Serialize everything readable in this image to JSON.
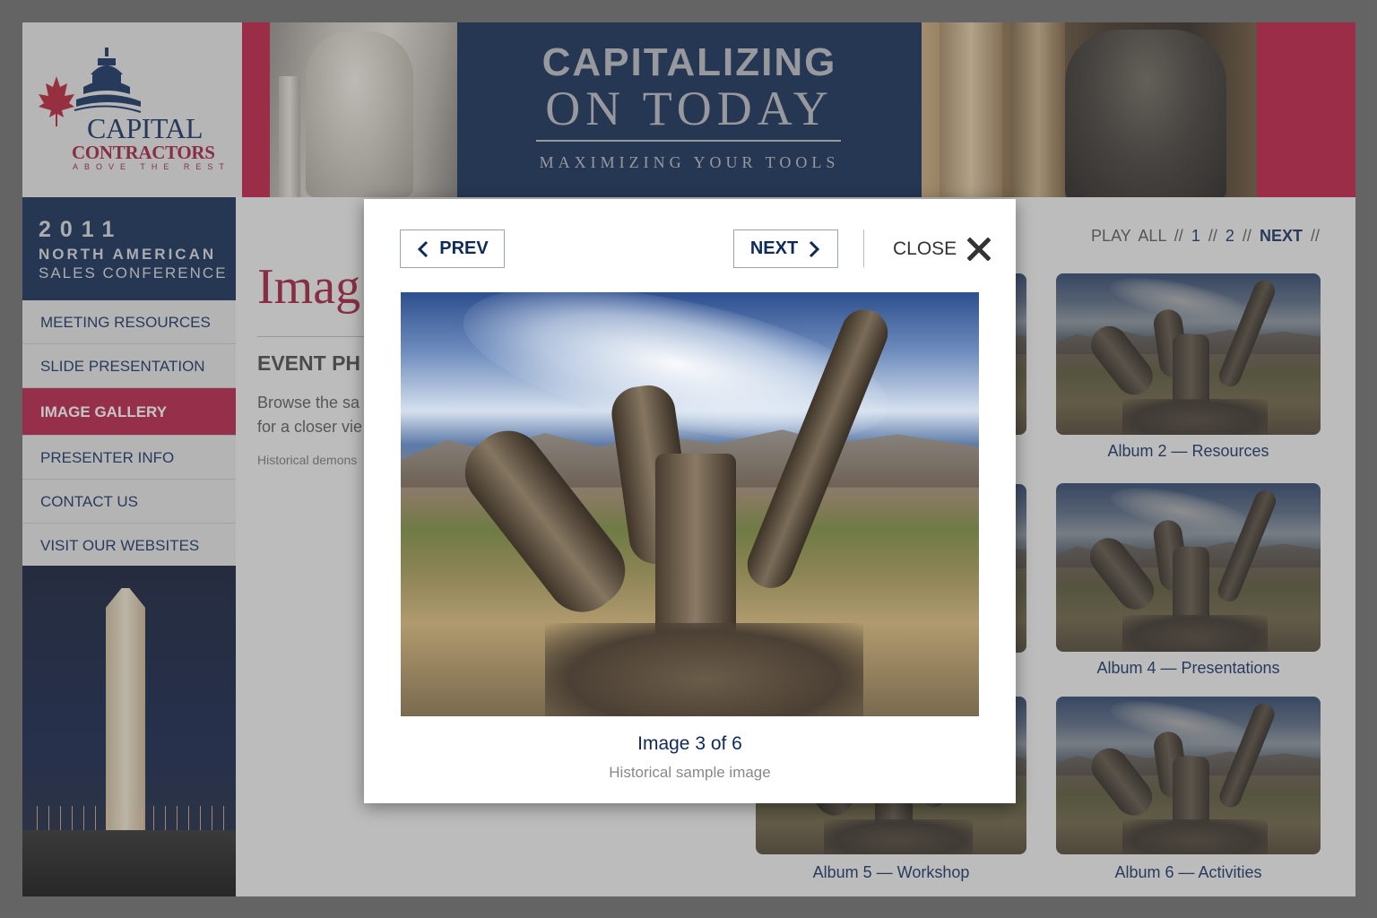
{
  "header": {
    "logo": {
      "line1": "CAPITAL",
      "line2": "CONTRACTORS",
      "tagline": "ABOVE THE REST"
    },
    "banner": {
      "line1": "CAPITALIZING",
      "line2": "ON TODAY",
      "line3": "MAXIMIZING YOUR TOOLS"
    }
  },
  "sidebar": {
    "conference": {
      "year": "2011",
      "line2": "NORTH AMERICAN",
      "line3": "SALES CONFERENCE"
    },
    "nav": [
      {
        "label": "MEETING RESOURCES",
        "active": false
      },
      {
        "label": "SLIDE PRESENTATION",
        "active": false
      },
      {
        "label": "IMAGE GALLERY",
        "active": true
      },
      {
        "label": "PRESENTER INFO",
        "active": false
      },
      {
        "label": "CONTACT US",
        "active": false
      },
      {
        "label": "VISIT OUR WEBSITES",
        "active": false
      }
    ]
  },
  "main": {
    "heading": "Imag",
    "subheading": "EVENT PH",
    "intro_line1": "Browse the sa",
    "intro_line2": "for a closer vie",
    "note": "Historical demons",
    "pager": {
      "play_all": "PLAY ALL",
      "sep": "//",
      "page1": "1",
      "page2": "2",
      "next": "NEXT"
    },
    "albums": [
      {
        "caption": "Album 2 — Resources"
      },
      {
        "caption": "Album 4 — Presentations"
      },
      {
        "caption": "Album 5 — Workshop"
      },
      {
        "caption": "Album 6 — Activities"
      }
    ]
  },
  "modal": {
    "prev_label": "PREV",
    "next_label": "NEXT",
    "close_label": "CLOSE",
    "counter": "Image 3 of 6",
    "caption": "Historical sample image"
  }
}
